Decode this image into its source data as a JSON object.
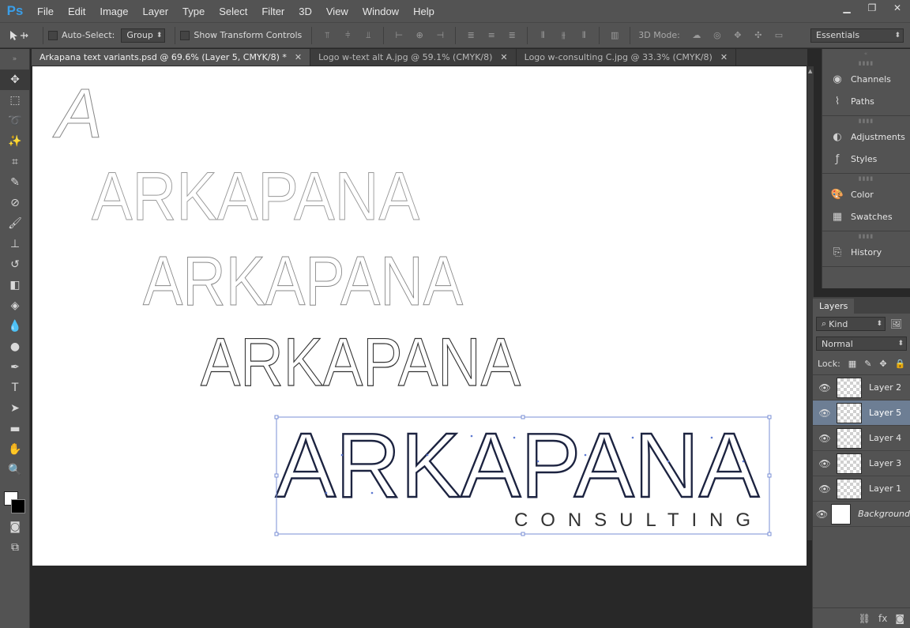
{
  "app": {
    "logo": "Ps"
  },
  "menu": [
    "File",
    "Edit",
    "Image",
    "Layer",
    "Type",
    "Select",
    "Filter",
    "3D",
    "View",
    "Window",
    "Help"
  ],
  "window_controls": {
    "minimize": "▁",
    "restore": "❐",
    "close": "✕"
  },
  "options": {
    "auto_select_label": "Auto-Select:",
    "auto_select_value": "Group",
    "show_transform_label": "Show Transform Controls",
    "mode_3d_label": "3D Mode:",
    "workspace": "Essentials"
  },
  "tabs": [
    {
      "label": "Arkapana text variants.psd @ 69.6% (Layer 5, CMYK/8) *",
      "close": "✕"
    },
    {
      "label": "Logo w-text alt A.jpg @ 59.1% (CMYK/8)",
      "close": "✕"
    },
    {
      "label": "Logo w-consulting C.jpg @ 33.3% (CMYK/8)",
      "close": "✕"
    }
  ],
  "canvas": {
    "single_letter": "A",
    "wordmark": "ARKAPANA",
    "tagline": "CONSULTING"
  },
  "dock": {
    "group1": [
      {
        "label": "Channels",
        "icon": "channels-icon"
      },
      {
        "label": "Paths",
        "icon": "paths-icon"
      }
    ],
    "group2": [
      {
        "label": "Adjustments",
        "icon": "adjustments-icon"
      },
      {
        "label": "Styles",
        "icon": "styles-icon"
      }
    ],
    "group3": [
      {
        "label": "Color",
        "icon": "color-icon"
      },
      {
        "label": "Swatches",
        "icon": "swatches-icon"
      }
    ],
    "group4": [
      {
        "label": "History",
        "icon": "history-icon"
      }
    ]
  },
  "layers_panel": {
    "tab": "Layers",
    "filter_kind": "Kind",
    "blend_mode": "Normal",
    "lock_label": "Lock:",
    "layers": [
      {
        "name": "Layer 2",
        "selected": false
      },
      {
        "name": "Layer 5",
        "selected": true
      },
      {
        "name": "Layer 4",
        "selected": false
      },
      {
        "name": "Layer 3",
        "selected": false
      },
      {
        "name": "Layer 1",
        "selected": false
      },
      {
        "name": "Background",
        "selected": false
      }
    ]
  },
  "colors": {
    "panel_bg": "#535353",
    "workspace_bg": "#282828",
    "selection_box": "#7a8fd6",
    "logo_fill": "#1c2340",
    "accent": "#3a9ee8"
  }
}
